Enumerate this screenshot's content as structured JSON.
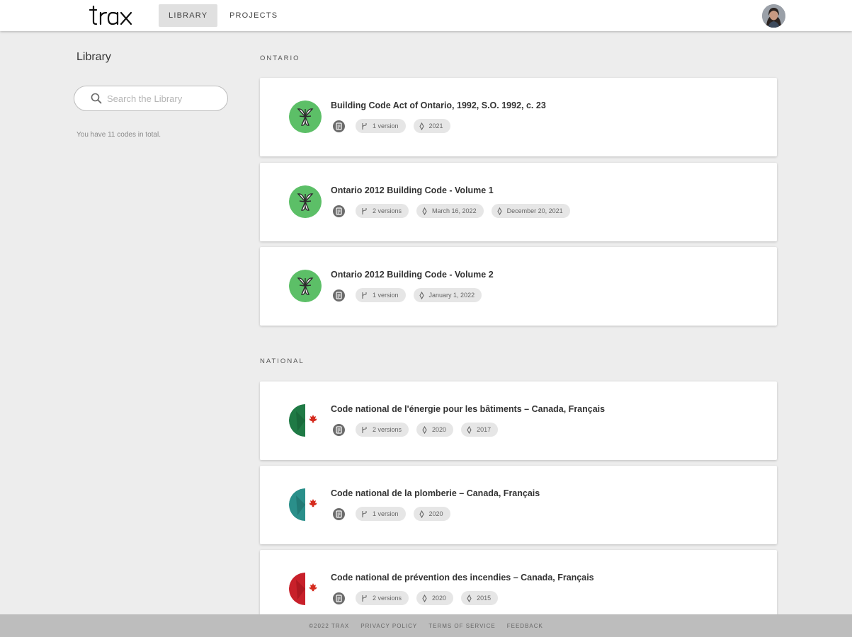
{
  "brand": "trax",
  "nav": {
    "library": "LIBRARY",
    "projects": "PROJECTS"
  },
  "sidebar": {
    "title": "Library",
    "search_placeholder": "Search the Library",
    "count_text": "You have 11 codes in total."
  },
  "sections": [
    {
      "label": "ONTARIO",
      "items": [
        {
          "emblem": "ontario-trillium",
          "title": "Building Code Act of Ontario, 1992, S.O. 1992, c. 23",
          "chips": [
            {
              "icon": "version-branch-icon",
              "text": "1 version"
            },
            {
              "icon": "date-diamond-icon",
              "text": "2021"
            }
          ]
        },
        {
          "emblem": "ontario-trillium",
          "title": "Ontario 2012 Building Code - Volume 1",
          "chips": [
            {
              "icon": "version-branch-icon",
              "text": "2 versions"
            },
            {
              "icon": "date-diamond-icon",
              "text": "March 16, 2022"
            },
            {
              "icon": "date-diamond-icon",
              "text": "December 20, 2021"
            }
          ]
        },
        {
          "emblem": "ontario-trillium",
          "title": "Ontario 2012 Building Code - Volume 2",
          "chips": [
            {
              "icon": "version-branch-icon",
              "text": "1 version"
            },
            {
              "icon": "date-diamond-icon",
              "text": "January 1, 2022"
            }
          ]
        }
      ]
    },
    {
      "label": "NATIONAL",
      "items": [
        {
          "emblem": "canada-dark-green",
          "title": "Code national de l'énergie pour les bâtiments – Canada, Français",
          "chips": [
            {
              "icon": "version-branch-icon",
              "text": "2 versions"
            },
            {
              "icon": "date-diamond-icon",
              "text": "2020"
            },
            {
              "icon": "date-diamond-icon",
              "text": "2017"
            }
          ]
        },
        {
          "emblem": "canada-teal",
          "title": "Code national de la plomberie – Canada, Français",
          "chips": [
            {
              "icon": "version-branch-icon",
              "text": "1 version"
            },
            {
              "icon": "date-diamond-icon",
              "text": "2020"
            }
          ]
        },
        {
          "emblem": "canada-red",
          "title": "Code national de prévention des incendies – Canada, Français",
          "chips": [
            {
              "icon": "version-branch-icon",
              "text": "2 versions"
            },
            {
              "icon": "date-diamond-icon",
              "text": "2020"
            },
            {
              "icon": "date-diamond-icon",
              "text": "2015"
            }
          ]
        }
      ]
    }
  ],
  "footer": {
    "copyright": "©2022 TRAX",
    "links": [
      "PRIVACY POLICY",
      "TERMS OF SERVICE",
      "FEEDBACK"
    ]
  },
  "colors": {
    "ontario_green": "#5cbf67",
    "canada_dark_green": "#1f7a45",
    "canada_teal": "#2a8f8a",
    "canada_red": "#c8202a",
    "maple_red": "#d52b1e"
  }
}
